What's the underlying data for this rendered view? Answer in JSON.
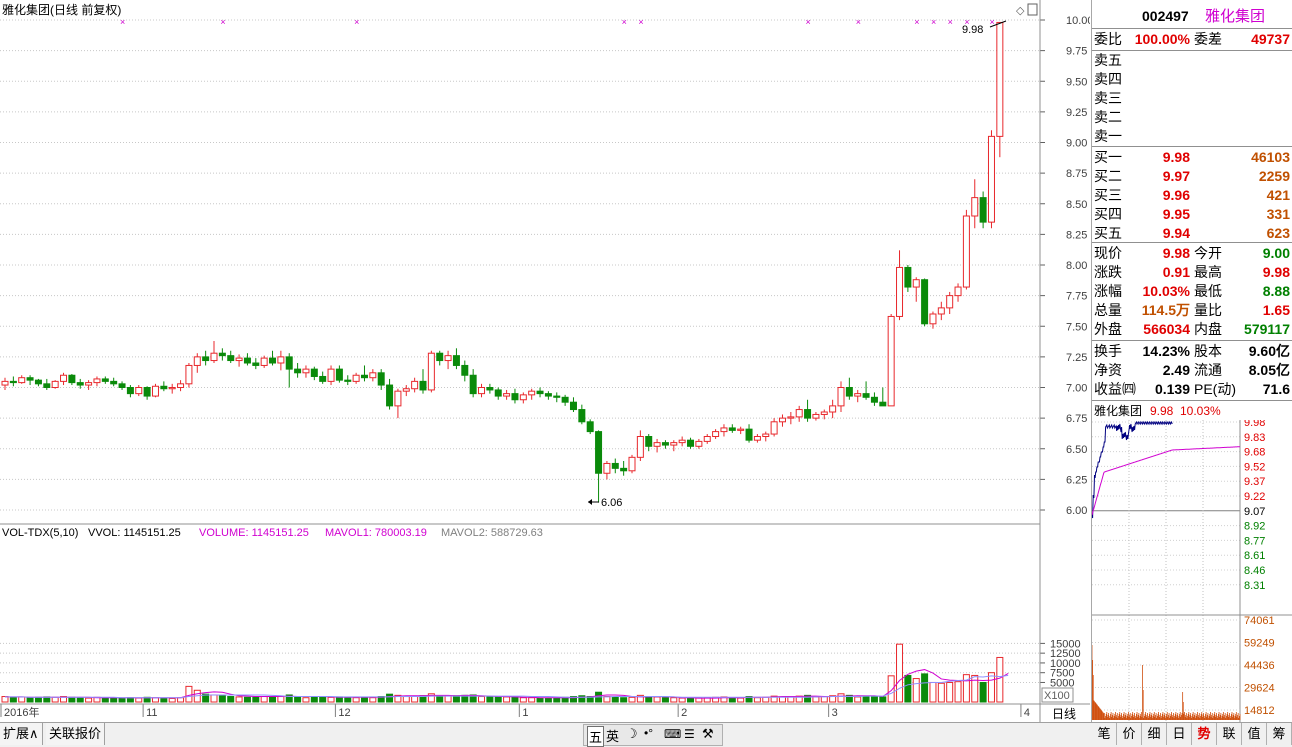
{
  "chart_title": "雅化集团(日线 前复权)",
  "stock": {
    "code": "002497",
    "name": "雅化集团"
  },
  "price_axis": {
    "ticks": [
      10.0,
      9.75,
      9.5,
      9.25,
      9.0,
      8.75,
      8.5,
      8.25,
      8.0,
      7.75,
      7.5,
      7.25,
      7.0,
      6.75,
      6.5,
      6.25,
      6.0
    ],
    "range": [
      5.95,
      10.05
    ]
  },
  "annotations": {
    "high_label": "9.98",
    "low_label": "6.06"
  },
  "volume_header": {
    "name": "VOL-TDX(5,10)",
    "vvol": "VVOL: 1145151.25",
    "volume": "VOLUME: 1145151.25",
    "mavol1": "MAVOL1: 780003.19",
    "mavol2": "MAVOL2: 588729.63"
  },
  "volume_axis": {
    "ticks": [
      "15000",
      "12500",
      "10000",
      "7500",
      "5000"
    ],
    "unit_label": "X100"
  },
  "date_axis": {
    "labels": [
      {
        "text": "2016年",
        "idx": 0
      },
      {
        "text": "11",
        "idx": 17
      },
      {
        "text": "12",
        "idx": 40
      },
      {
        "text": "1",
        "idx": 62
      },
      {
        "text": "2",
        "idx": 81
      },
      {
        "text": "3",
        "idx": 99
      },
      {
        "text": "4",
        "idx": 122
      }
    ],
    "period_label": "日线"
  },
  "colors": {
    "up": "#e8282c",
    "down": "#0a8a0a",
    "ma1": "#d000d0",
    "ma2": "#9090ff",
    "grid": "#c8c8c8"
  },
  "chart_data": {
    "type": "candlestick",
    "candles": [
      [
        7.02,
        7.08,
        6.98,
        7.05,
        14
      ],
      [
        7.05,
        7.09,
        7.01,
        7.04,
        12
      ],
      [
        7.04,
        7.1,
        7.03,
        7.08,
        13
      ],
      [
        7.08,
        7.1,
        7.02,
        7.06,
        11
      ],
      [
        7.06,
        7.07,
        7.01,
        7.03,
        12
      ],
      [
        7.03,
        7.07,
        6.98,
        7.0,
        13
      ],
      [
        7.0,
        7.06,
        6.99,
        7.05,
        12
      ],
      [
        7.05,
        7.12,
        7.02,
        7.1,
        14
      ],
      [
        7.1,
        7.11,
        7.02,
        7.04,
        12
      ],
      [
        7.04,
        7.07,
        6.99,
        7.02,
        11
      ],
      [
        7.02,
        7.06,
        6.98,
        7.04,
        10
      ],
      [
        7.04,
        7.09,
        7.01,
        7.07,
        12
      ],
      [
        7.07,
        7.09,
        7.03,
        7.05,
        10
      ],
      [
        7.05,
        7.08,
        7.01,
        7.03,
        11
      ],
      [
        7.03,
        7.05,
        6.98,
        7.0,
        9
      ],
      [
        7.0,
        7.02,
        6.92,
        6.95,
        11
      ],
      [
        6.95,
        7.02,
        6.93,
        7.0,
        10
      ],
      [
        7.0,
        7.01,
        6.9,
        6.93,
        12
      ],
      [
        6.93,
        7.03,
        6.92,
        7.01,
        11
      ],
      [
        7.01,
        7.05,
        6.97,
        6.99,
        10
      ],
      [
        6.99,
        7.03,
        6.95,
        7.0,
        9
      ],
      [
        7.0,
        7.06,
        6.97,
        7.03,
        11
      ],
      [
        7.03,
        7.2,
        7.0,
        7.18,
        40
      ],
      [
        7.18,
        7.28,
        7.12,
        7.25,
        30
      ],
      [
        7.25,
        7.3,
        7.18,
        7.22,
        20
      ],
      [
        7.22,
        7.38,
        7.2,
        7.28,
        18
      ],
      [
        7.28,
        7.32,
        7.22,
        7.26,
        16
      ],
      [
        7.26,
        7.3,
        7.2,
        7.22,
        14
      ],
      [
        7.22,
        7.27,
        7.17,
        7.24,
        13
      ],
      [
        7.24,
        7.28,
        7.18,
        7.2,
        12
      ],
      [
        7.2,
        7.24,
        7.15,
        7.18,
        12
      ],
      [
        7.18,
        7.26,
        7.16,
        7.24,
        14
      ],
      [
        7.24,
        7.3,
        7.18,
        7.2,
        13
      ],
      [
        7.2,
        7.3,
        7.14,
        7.25,
        14
      ],
      [
        7.25,
        7.28,
        7.0,
        7.15,
        18
      ],
      [
        7.15,
        7.2,
        7.08,
        7.12,
        12
      ],
      [
        7.12,
        7.18,
        7.08,
        7.15,
        11
      ],
      [
        7.15,
        7.17,
        7.06,
        7.09,
        13
      ],
      [
        7.09,
        7.13,
        7.03,
        7.05,
        14
      ],
      [
        7.05,
        7.18,
        7.02,
        7.15,
        12
      ],
      [
        7.15,
        7.18,
        7.04,
        7.06,
        13
      ],
      [
        7.06,
        7.1,
        7.02,
        7.05,
        12
      ],
      [
        7.05,
        7.12,
        7.03,
        7.1,
        11
      ],
      [
        7.1,
        7.18,
        7.05,
        7.08,
        12
      ],
      [
        7.08,
        7.15,
        7.05,
        7.12,
        11
      ],
      [
        7.12,
        7.15,
        6.98,
        7.02,
        14
      ],
      [
        7.02,
        7.07,
        6.82,
        6.85,
        20
      ],
      [
        6.85,
        6.99,
        6.75,
        6.97,
        17
      ],
      [
        6.97,
        7.02,
        6.93,
        6.99,
        14
      ],
      [
        6.99,
        7.08,
        6.96,
        7.05,
        15
      ],
      [
        7.05,
        7.15,
        6.95,
        6.98,
        16
      ],
      [
        6.98,
        7.3,
        6.96,
        7.28,
        21
      ],
      [
        7.28,
        7.3,
        7.18,
        7.22,
        15
      ],
      [
        7.22,
        7.3,
        7.15,
        7.26,
        16
      ],
      [
        7.26,
        7.32,
        7.15,
        7.18,
        16
      ],
      [
        7.18,
        7.22,
        7.05,
        7.1,
        17
      ],
      [
        7.1,
        7.15,
        6.92,
        6.95,
        18
      ],
      [
        6.95,
        7.03,
        6.92,
        7.0,
        14
      ],
      [
        7.0,
        7.03,
        6.95,
        6.98,
        13
      ],
      [
        6.98,
        7.0,
        6.9,
        6.93,
        14
      ],
      [
        6.93,
        6.98,
        6.9,
        6.95,
        13
      ],
      [
        6.95,
        6.99,
        6.87,
        6.9,
        12
      ],
      [
        6.9,
        6.96,
        6.87,
        6.94,
        11
      ],
      [
        6.94,
        6.99,
        6.9,
        6.97,
        11
      ],
      [
        6.97,
        7.0,
        6.92,
        6.95,
        10
      ],
      [
        6.95,
        6.97,
        6.9,
        6.93,
        10
      ],
      [
        6.93,
        6.96,
        6.88,
        6.92,
        10
      ],
      [
        6.92,
        6.94,
        6.85,
        6.88,
        12
      ],
      [
        6.88,
        6.92,
        6.8,
        6.82,
        14
      ],
      [
        6.82,
        6.86,
        6.7,
        6.72,
        16
      ],
      [
        6.72,
        6.74,
        6.62,
        6.64,
        14
      ],
      [
        6.64,
        6.65,
        6.06,
        6.3,
        25
      ],
      [
        6.3,
        6.4,
        6.25,
        6.38,
        14
      ],
      [
        6.38,
        6.42,
        6.3,
        6.34,
        12
      ],
      [
        6.34,
        6.4,
        6.28,
        6.32,
        11
      ],
      [
        6.32,
        6.45,
        6.3,
        6.43,
        12
      ],
      [
        6.43,
        6.65,
        6.4,
        6.6,
        17
      ],
      [
        6.6,
        6.62,
        6.48,
        6.52,
        14
      ],
      [
        6.52,
        6.58,
        6.47,
        6.55,
        13
      ],
      [
        6.55,
        6.57,
        6.5,
        6.53,
        11
      ],
      [
        6.53,
        6.57,
        6.48,
        6.55,
        11
      ],
      [
        6.55,
        6.6,
        6.52,
        6.57,
        10
      ],
      [
        6.57,
        6.59,
        6.5,
        6.52,
        10
      ],
      [
        6.52,
        6.58,
        6.5,
        6.56,
        10
      ],
      [
        6.56,
        6.62,
        6.54,
        6.6,
        11
      ],
      [
        6.6,
        6.66,
        6.58,
        6.64,
        12
      ],
      [
        6.64,
        6.7,
        6.6,
        6.67,
        13
      ],
      [
        6.67,
        6.7,
        6.63,
        6.65,
        11
      ],
      [
        6.65,
        6.68,
        6.62,
        6.66,
        10
      ],
      [
        6.66,
        6.7,
        6.55,
        6.57,
        14
      ],
      [
        6.57,
        6.62,
        6.55,
        6.6,
        11
      ],
      [
        6.6,
        6.64,
        6.56,
        6.62,
        12
      ],
      [
        6.62,
        6.75,
        6.6,
        6.72,
        15
      ],
      [
        6.72,
        6.78,
        6.68,
        6.75,
        13
      ],
      [
        6.75,
        6.8,
        6.7,
        6.76,
        14
      ],
      [
        6.76,
        6.85,
        6.72,
        6.82,
        15
      ],
      [
        6.82,
        6.9,
        6.72,
        6.75,
        17
      ],
      [
        6.75,
        6.8,
        6.73,
        6.78,
        13
      ],
      [
        6.78,
        6.82,
        6.74,
        6.8,
        14
      ],
      [
        6.8,
        6.9,
        6.75,
        6.85,
        16
      ],
      [
        6.85,
        7.05,
        6.8,
        7.0,
        21
      ],
      [
        7.0,
        7.08,
        6.9,
        6.93,
        17
      ],
      [
        6.93,
        6.98,
        6.88,
        6.95,
        13
      ],
      [
        6.95,
        7.05,
        6.9,
        6.92,
        15
      ],
      [
        6.92,
        6.96,
        6.85,
        6.88,
        13
      ],
      [
        6.88,
        7.0,
        6.85,
        6.85,
        13
      ],
      [
        6.85,
        7.6,
        6.85,
        7.58,
        67
      ],
      [
        7.58,
        8.12,
        7.55,
        7.98,
        148
      ],
      [
        7.98,
        8.0,
        7.78,
        7.82,
        68
      ],
      [
        7.82,
        7.9,
        7.7,
        7.88,
        60
      ],
      [
        7.88,
        7.89,
        7.5,
        7.52,
        72
      ],
      [
        7.52,
        7.62,
        7.48,
        7.6,
        50
      ],
      [
        7.6,
        7.7,
        7.55,
        7.65,
        48
      ],
      [
        7.65,
        7.78,
        7.6,
        7.75,
        50
      ],
      [
        7.75,
        7.85,
        7.7,
        7.82,
        52
      ],
      [
        7.82,
        8.45,
        7.8,
        8.4,
        70
      ],
      [
        8.4,
        8.7,
        8.3,
        8.55,
        68
      ],
      [
        8.55,
        8.6,
        8.3,
        8.35,
        50
      ],
      [
        8.35,
        9.1,
        8.3,
        9.05,
        75
      ],
      [
        9.05,
        9.98,
        8.88,
        9.98,
        114
      ]
    ],
    "ma1": [
      13,
      13,
      13,
      12,
      12,
      12,
      12,
      12,
      12,
      12,
      12,
      11,
      11,
      11,
      11,
      11,
      11,
      11,
      11,
      11,
      11,
      11,
      17,
      21,
      24,
      26,
      25,
      20,
      16,
      15,
      14,
      14,
      14,
      14,
      15,
      14,
      14,
      14,
      14,
      13,
      12,
      12,
      12,
      12,
      12,
      12,
      14,
      15,
      16,
      16,
      16,
      17,
      17,
      17,
      16,
      17,
      17,
      16,
      15,
      14,
      14,
      13,
      12,
      12,
      11,
      11,
      11,
      11,
      11,
      12,
      13,
      16,
      18,
      18,
      17,
      14,
      13,
      13,
      14,
      13,
      13,
      11,
      11,
      10,
      10,
      10,
      11,
      11,
      11,
      12,
      12,
      12,
      13,
      14,
      14,
      14,
      15,
      15,
      14,
      14,
      15,
      15,
      16,
      16,
      16,
      14,
      29,
      55,
      71,
      79,
      83,
      74,
      59,
      56,
      55,
      54,
      56,
      55,
      56,
      61,
      73
    ],
    "ma2": [
      13,
      13,
      13,
      12,
      12,
      12,
      12,
      12,
      12,
      12,
      12,
      12,
      12,
      12,
      11,
      11,
      11,
      11,
      11,
      11,
      11,
      11,
      14,
      16,
      18,
      18,
      18,
      18,
      18,
      18,
      18,
      18,
      17,
      16,
      14,
      14,
      14,
      14,
      14,
      14,
      13,
      13,
      13,
      13,
      13,
      13,
      13,
      14,
      14,
      14,
      14,
      15,
      15,
      15,
      15,
      15,
      15,
      15,
      15,
      15,
      15,
      15,
      15,
      14,
      14,
      14,
      13,
      12,
      12,
      12,
      12,
      13,
      13,
      14,
      14,
      14,
      14,
      14,
      14,
      14,
      13,
      12,
      12,
      12,
      12,
      12,
      12,
      12,
      12,
      12,
      12,
      12,
      12,
      12,
      12,
      12,
      12,
      13,
      13,
      14,
      14,
      14,
      14,
      15,
      15,
      15,
      22,
      35,
      44,
      47,
      49,
      50,
      50,
      53,
      55,
      56,
      65,
      64,
      67,
      65,
      68
    ]
  },
  "quote": {
    "wei_bi_label": "委比",
    "wei_bi_value": "100.00%",
    "wei_cha_label": "委差",
    "wei_cha_value": "49737",
    "sell": [
      {
        "label": "卖五",
        "price": "",
        "vol": ""
      },
      {
        "label": "卖四",
        "price": "",
        "vol": ""
      },
      {
        "label": "卖三",
        "price": "",
        "vol": ""
      },
      {
        "label": "卖二",
        "price": "",
        "vol": ""
      },
      {
        "label": "卖一",
        "price": "",
        "vol": ""
      }
    ],
    "buy": [
      {
        "label": "买一",
        "price": "9.98",
        "vol": "46103"
      },
      {
        "label": "买二",
        "price": "9.97",
        "vol": "2259"
      },
      {
        "label": "买三",
        "price": "9.96",
        "vol": "421"
      },
      {
        "label": "买四",
        "price": "9.95",
        "vol": "331"
      },
      {
        "label": "买五",
        "price": "9.94",
        "vol": "623"
      }
    ],
    "stats1": [
      {
        "l1": "现价",
        "v1": "9.98",
        "c1": "red",
        "l2": "今开",
        "v2": "9.00",
        "c2": "green"
      },
      {
        "l1": "涨跌",
        "v1": "0.91",
        "c1": "red",
        "l2": "最高",
        "v2": "9.98",
        "c2": "red"
      },
      {
        "l1": "涨幅",
        "v1": "10.03%",
        "c1": "red",
        "l2": "最低",
        "v2": "8.88",
        "c2": "green"
      },
      {
        "l1": "总量",
        "v1": "114.5万",
        "c1": "orange",
        "l2": "量比",
        "v2": "1.65",
        "c2": "red"
      },
      {
        "l1": "外盘",
        "v1": "566034",
        "c1": "red",
        "l2": "内盘",
        "v2": "579117",
        "c2": "green"
      }
    ],
    "stats2": [
      {
        "l1": "换手",
        "v1": "14.23%",
        "l2": "股本",
        "v2": "9.60亿"
      },
      {
        "l1": "净资",
        "v1": "2.49",
        "l2": "流通",
        "v2": "8.05亿"
      },
      {
        "l1": "收益㈣",
        "v1": "0.139",
        "l2": "PE(动)",
        "v2": "71.6"
      }
    ]
  },
  "intraday": {
    "title": "雅化集团",
    "price": "9.98",
    "pct": "10.03%",
    "price_ticks": [
      "9.98",
      "9.83",
      "9.68",
      "9.52",
      "9.37",
      "9.22",
      "9.07",
      "8.92",
      "8.77",
      "8.61",
      "8.46",
      "8.31"
    ],
    "vol_ticks": [
      "74061",
      "59249",
      "44436",
      "29624",
      "14812"
    ]
  },
  "bottom_tabs": [
    "扩展∧",
    "关联报价"
  ],
  "right_tabs": [
    "笔",
    "价",
    "细",
    "日",
    "势",
    "联",
    "值",
    "筹"
  ],
  "ime_items": [
    "五",
    "英"
  ]
}
